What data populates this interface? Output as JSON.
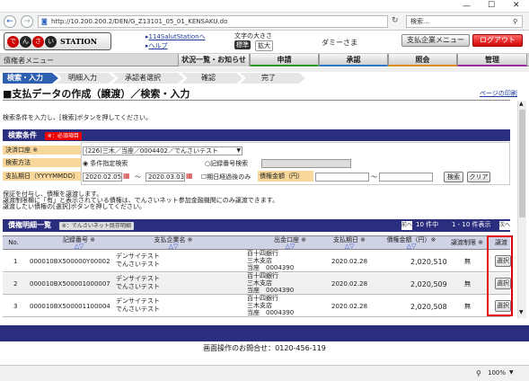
{
  "browser": {
    "url": "http://10.200.200.2/DEN/G_Z13101_05_01_KENSAKU.do",
    "search_placeholder": "検索...",
    "zoom": "100%"
  },
  "header": {
    "logo_chars": [
      "で",
      "ん",
      "さ",
      "い"
    ],
    "logo_text": "STATION",
    "link1": "114SalutStationへ",
    "link2": "ヘルプ",
    "font_size_label": "文字の大きさ",
    "font_std": "標準",
    "font_large": "拡大",
    "user": "ダミーさま",
    "payment_menu": "支払企業メニュー",
    "logout": "ログアウト",
    "breadcrumb_menu": "債権者メニュー"
  },
  "menu": {
    "items": [
      "状況一覧・お知らせ",
      "申請",
      "承認",
      "照会",
      "管理"
    ]
  },
  "steps": [
    "検索・入力",
    "明細入力",
    "承認者選択",
    "確認",
    "完了"
  ],
  "page": {
    "title": "■支払データの作成（譲渡）／検索・入力",
    "print_link": "ページの印刷",
    "instruction": "検索条件を入力し、[検索]ボタンを押してください。"
  },
  "search": {
    "section_title": "検索条件",
    "required_badge": "※：必須項目",
    "account_label": "決済口座 ※",
    "account_value": "(226)三木／当座／0004402／でんさいテスト",
    "method_label": "検索方法",
    "method_opt1": "条件指定検索",
    "method_opt2": "記録番号検索",
    "date_label": "支払期日（YYYYMMDD）",
    "date_from": "2020.02.05",
    "date_to": "2020.03.03",
    "date_sep": "～",
    "after_due_label": "期日経過後のみ",
    "amount_label": "債権金額（円）",
    "amount_sep": "～",
    "search_btn": "検索",
    "clear_btn": "クリア",
    "notes": [
      "保証を付与し、債権を譲渡します。",
      "譲渡制限欄に「有」と表示されている債権は、でんさいネット参加金融機関にのみ譲渡できます。",
      "譲渡したい債権の[選択]ボタンを押してください。"
    ]
  },
  "list": {
    "section_title": "債権明細一覧",
    "badge": "※：でんさいネット既存明細",
    "prev": "前へ",
    "count": "10 件中",
    "range": "1 - 10 件表示",
    "next": "次へ",
    "headers": {
      "no": "No.",
      "record": "記録番号 ※",
      "company": "支払企業名 ※",
      "account": "出金口座 ※",
      "due": "支払期日 ※",
      "amount": "債権金額（円）※",
      "restrict": "譲渡制限 ※",
      "action": "譲渡"
    },
    "rows": [
      {
        "no": "1",
        "record": "000010BX500000Y00002",
        "kana": "デンサイテスト",
        "name": "でんさいテスト",
        "bank": "百十四銀行",
        "branch": "三木支店",
        "acct": "当座　0004390",
        "due": "2020.02.28",
        "amount": "2,020,510",
        "restrict": "無",
        "action": "選択"
      },
      {
        "no": "2",
        "record": "000010BX500001000007",
        "kana": "デンサイテスト",
        "name": "でんさいテスト",
        "bank": "百十四銀行",
        "branch": "三木支店",
        "acct": "当座　0004390",
        "due": "2020.02.28",
        "amount": "2,020,509",
        "restrict": "無",
        "action": "選択"
      },
      {
        "no": "3",
        "record": "000010BX500001100004",
        "kana": "デンサイテスト",
        "name": "でんさいテスト",
        "bank": "百十四銀行",
        "branch": "三木支店",
        "acct": "当座　0004390",
        "due": "2020.02.28",
        "amount": "2,020,508",
        "restrict": "無",
        "action": "選択"
      }
    ]
  },
  "footer": {
    "inquiry": "画面操作のお問合せ：0120-456-119"
  }
}
